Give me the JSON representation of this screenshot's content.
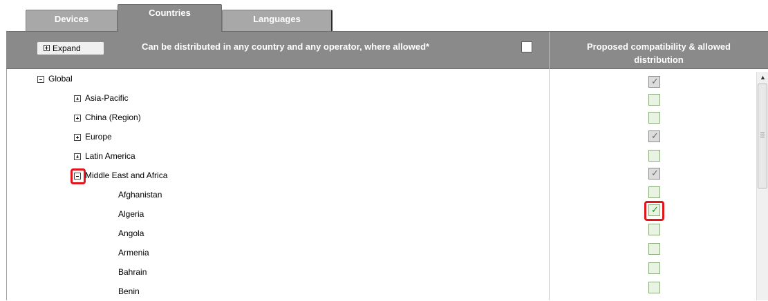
{
  "tabs": [
    {
      "label": "Devices",
      "active": false
    },
    {
      "label": "Countries",
      "active": true
    },
    {
      "label": "Languages",
      "active": false
    }
  ],
  "header": {
    "expand_label": "Expand",
    "distribution_text": "Can be distributed in any country and any operator, where allowed*",
    "distribution_checked": false,
    "column_header_line1": "Proposed compatibility & allowed",
    "column_header_line2": "distribution"
  },
  "tree": [
    {
      "label": "Global",
      "level": 0,
      "toggle": "minus",
      "check": "gray-checked"
    },
    {
      "label": "Asia-Pacific",
      "level": 1,
      "toggle": "plus",
      "check": "unchecked"
    },
    {
      "label": "China (Region)",
      "level": 1,
      "toggle": "plus",
      "check": "unchecked"
    },
    {
      "label": "Europe",
      "level": 1,
      "toggle": "plus",
      "check": "gray-checked"
    },
    {
      "label": "Latin America",
      "level": 1,
      "toggle": "plus",
      "check": "unchecked"
    },
    {
      "label": "Middle East and Africa",
      "level": 1,
      "toggle": "minus",
      "check": "gray-checked",
      "highlighted_toggle": true
    },
    {
      "label": "Afghanistan",
      "level": 2,
      "toggle": null,
      "check": "unchecked"
    },
    {
      "label": "Algeria",
      "level": 2,
      "toggle": null,
      "check": "checked",
      "highlighted_check": true
    },
    {
      "label": "Angola",
      "level": 2,
      "toggle": null,
      "check": "unchecked"
    },
    {
      "label": "Armenia",
      "level": 2,
      "toggle": null,
      "check": "unchecked"
    },
    {
      "label": "Bahrain",
      "level": 2,
      "toggle": null,
      "check": "unchecked"
    },
    {
      "label": "Benin",
      "level": 2,
      "toggle": null,
      "check": "unchecked"
    }
  ],
  "colors": {
    "header_bg": "#8a8a8a",
    "tab_bg": "#a8a8a8",
    "highlight": "#e4141b",
    "check_green": "#1a8a1a"
  }
}
